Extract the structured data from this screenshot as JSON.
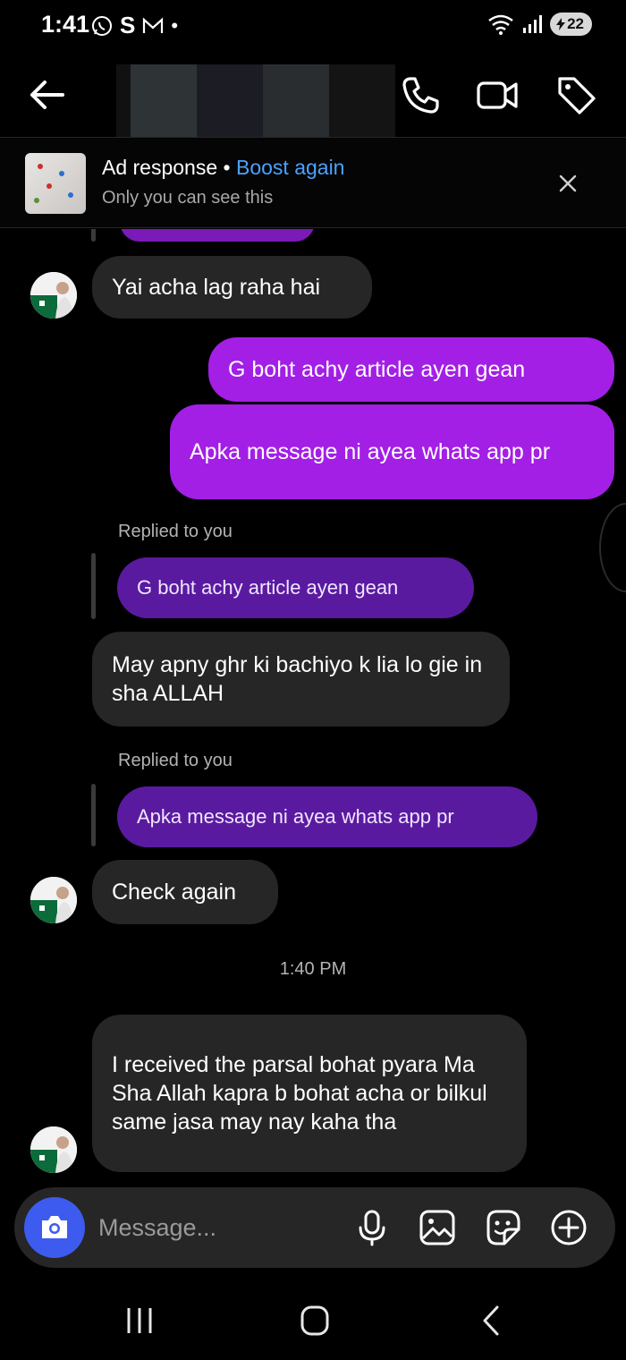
{
  "status_bar": {
    "time": "1:41",
    "left_icons": [
      "whatsapp-icon",
      "S",
      "mail-icon",
      "•"
    ],
    "battery": "22"
  },
  "header": {
    "contact_name": "",
    "actions": [
      "phone-icon",
      "video-icon",
      "tag-icon"
    ]
  },
  "ad_banner": {
    "title": "Ad response",
    "separator": "•",
    "boost_label": "Boost again",
    "subtitle": "Only you can see this",
    "colors": {
      "boost": "#4aa3ff"
    }
  },
  "messages": [
    {
      "dir": "in",
      "text": "Yai acha lag raha hai"
    },
    {
      "dir": "out",
      "text": "G boht achy article  ayen gean"
    },
    {
      "dir": "out",
      "text": "Apka message  ni ayea whats app pr"
    },
    {
      "dir": "in",
      "reply_label": "Replied to you",
      "quote": "G boht achy article  ayen gean",
      "text": "May apny ghr ki bachiyo k lia lo gie in sha ALLAH"
    },
    {
      "dir": "in",
      "reply_label": "Replied to you",
      "quote": "Apka message  ni ayea whats app pr",
      "text": "Check again"
    },
    {
      "timestamp": "1:40 PM"
    },
    {
      "dir": "in",
      "text": "I received the parsal bohat pyara Ma Sha Allah kapra b bohat acha or bilkul same jasa may nay kaha tha"
    }
  ],
  "composer": {
    "placeholder": "Message...",
    "icons": [
      "camera-icon",
      "microphone-icon",
      "gallery-icon",
      "sticker-icon",
      "plus-icon"
    ]
  },
  "colors": {
    "outgoing_bubble": "#a31fe6",
    "incoming_bubble": "#262626",
    "reply_quote": "#5a1aa0",
    "camera_button": "#3e5bf0"
  }
}
